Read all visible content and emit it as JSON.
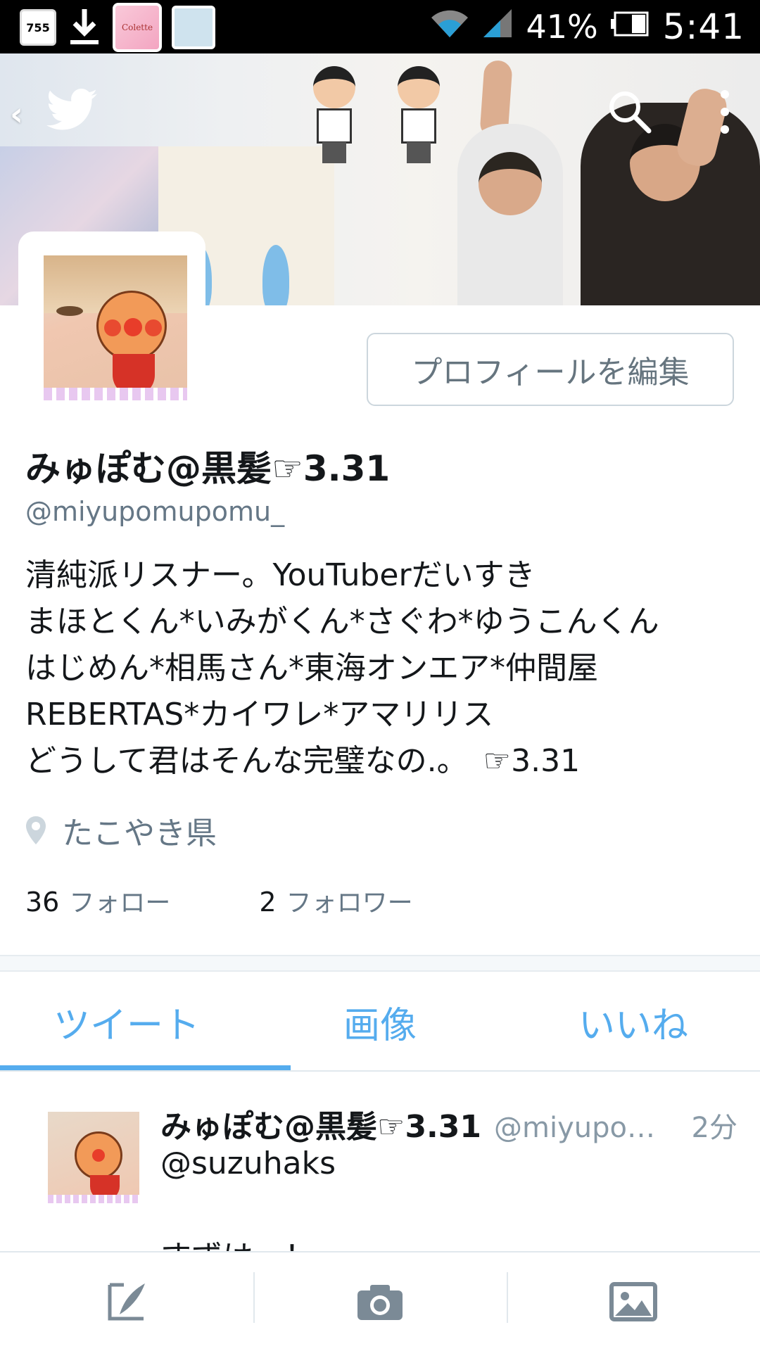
{
  "status_bar": {
    "app_icon_1": "755",
    "app_icon_pink": "Colette",
    "battery": "41%",
    "time": "5:41"
  },
  "profile": {
    "display_name": "みゅぽむ@黒髪☞3.31",
    "handle": "@miyupomupomu_",
    "bio_lines": [
      "清純派リスナー。YouTuberだいすき",
      "まほとくん*いみがくん*さぐわ*ゆうこんくん",
      "はじめん*相馬さん*東海オンエア*仲間屋",
      "REBERTAS*カイワレ*アマリリス",
      "どうして君はそんな完璧なの.。　☞3.31"
    ],
    "location": "たこやき県",
    "edit_button": "プロフィールを編集",
    "following_count": "36",
    "following_label": "フォロー",
    "followers_count": "2",
    "followers_label": "フォロワー"
  },
  "tabs": [
    {
      "label": "ツイート",
      "active": true
    },
    {
      "label": "画像",
      "active": false
    },
    {
      "label": "いいね",
      "active": false
    }
  ],
  "tweet": {
    "name": "みゅぽむ@黒髪☞3.31",
    "handle": "@miyupom...",
    "time": "2分",
    "reply_to": "@suzuhaks",
    "text": "すずは〜！"
  },
  "bottom_bar": {
    "items": [
      "compose-icon",
      "camera-icon",
      "image-icon"
    ]
  },
  "colors": {
    "accent": "#55acee",
    "text": "#14171a",
    "secondary": "#657786"
  }
}
